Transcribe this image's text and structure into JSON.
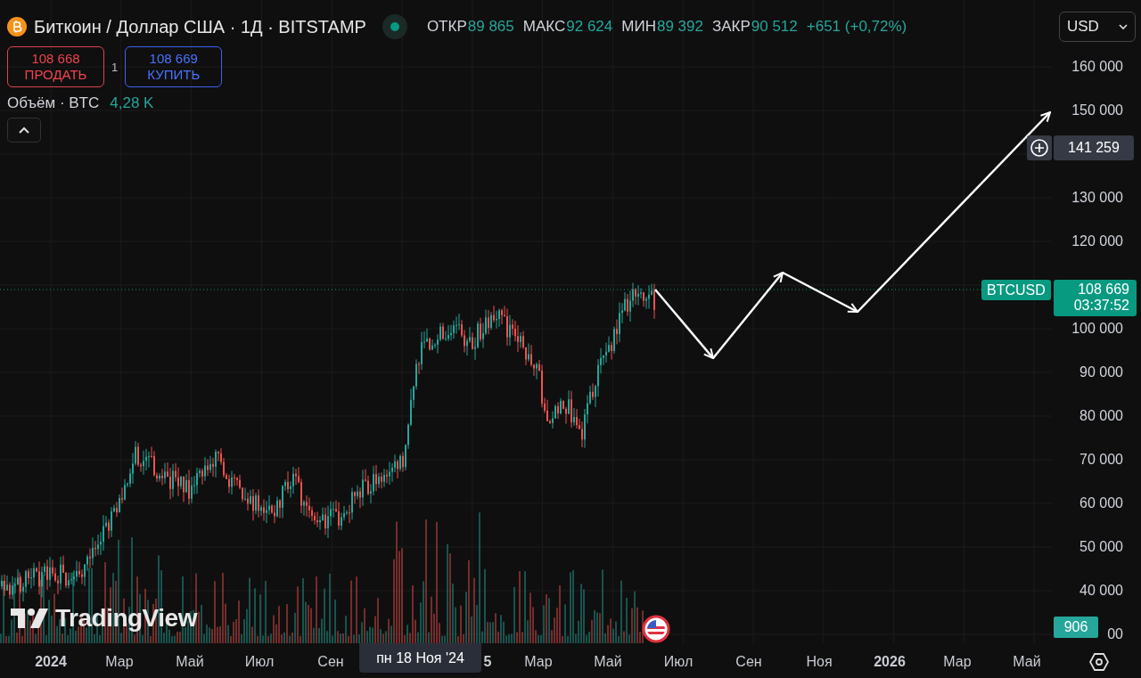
{
  "header": {
    "title": "Биткоин / Доллар США · 1Д · BITSTAMP",
    "market_open": true,
    "stats": [
      {
        "label": "ОТКР",
        "value": "89 865"
      },
      {
        "label": "МАКС",
        "value": "92 624"
      },
      {
        "label": "МИН",
        "value": "89 392"
      },
      {
        "label": "ЗАКР",
        "value": "90 512"
      }
    ],
    "change": "+651 (+0,72%)"
  },
  "trade": {
    "sell": {
      "price": "108 668",
      "label": "ПРОДАТЬ"
    },
    "spread": "1",
    "buy": {
      "price": "108 669",
      "label": "КУПИТЬ"
    }
  },
  "volume_legend": {
    "label": "Объём · BTC",
    "value": "4,28 K"
  },
  "currency": "USD",
  "price_axis": {
    "ticks": [
      "160 000",
      "150 000",
      "130 000",
      "120 000",
      "100 000",
      "90 000",
      "80 000",
      "70 000",
      "60 000",
      "50 000",
      "40 000",
      "00"
    ]
  },
  "price_labels": {
    "drawing_price": "141 259",
    "symbol": "BTCUSD",
    "last": "108 669",
    "countdown": "03:37:52",
    "volume": "906"
  },
  "time_axis": {
    "labels": [
      {
        "text": "2024",
        "kind": "year"
      },
      {
        "text": "Мар",
        "kind": "month"
      },
      {
        "text": "Май",
        "kind": "month"
      },
      {
        "text": "Июл",
        "kind": "month"
      },
      {
        "text": "Сен",
        "kind": "month"
      },
      {
        "text": "5",
        "kind": "year"
      },
      {
        "text": "Мар",
        "kind": "month"
      },
      {
        "text": "Май",
        "kind": "month"
      },
      {
        "text": "Июл",
        "kind": "month"
      },
      {
        "text": "Сен",
        "kind": "month"
      },
      {
        "text": "Ноя",
        "kind": "month"
      },
      {
        "text": "2026",
        "kind": "year"
      },
      {
        "text": "Мар",
        "kind": "month"
      },
      {
        "text": "Май",
        "kind": "month"
      }
    ]
  },
  "crosshair": {
    "date": "пн 18 Ноя '24"
  },
  "logo": "TradingView"
}
